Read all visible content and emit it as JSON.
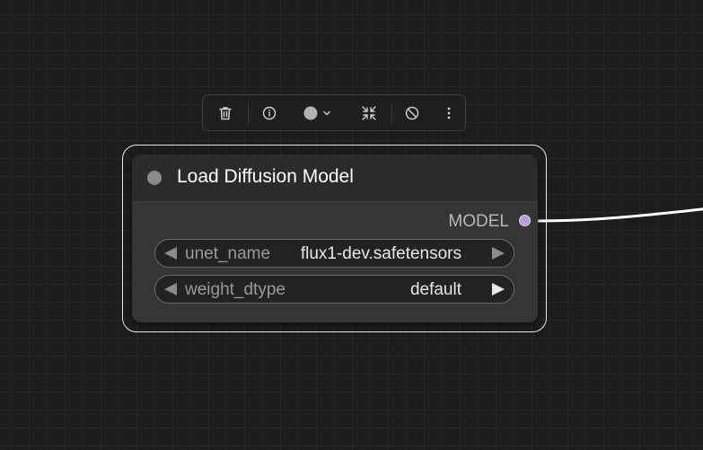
{
  "toolbar": {
    "buttons": [
      {
        "name": "delete",
        "icon": "trash-icon"
      },
      {
        "name": "info",
        "icon": "info-icon"
      },
      {
        "name": "color",
        "icon": "color-dot-icon",
        "color": "#b3b3b3"
      },
      {
        "name": "collapse",
        "icon": "shrink-icon"
      },
      {
        "name": "bypass",
        "icon": "ban-icon"
      },
      {
        "name": "more",
        "icon": "more-vertical-icon"
      }
    ]
  },
  "node": {
    "title": "Load Diffusion Model",
    "selected": true,
    "outputs": [
      {
        "label": "MODEL",
        "color": "#b79edb"
      }
    ],
    "widgets": [
      {
        "name": "unet_name",
        "value": "flux1-dev.safetensors"
      },
      {
        "name": "weight_dtype",
        "value": "default"
      }
    ]
  },
  "link": {
    "color": "#ffffff"
  }
}
